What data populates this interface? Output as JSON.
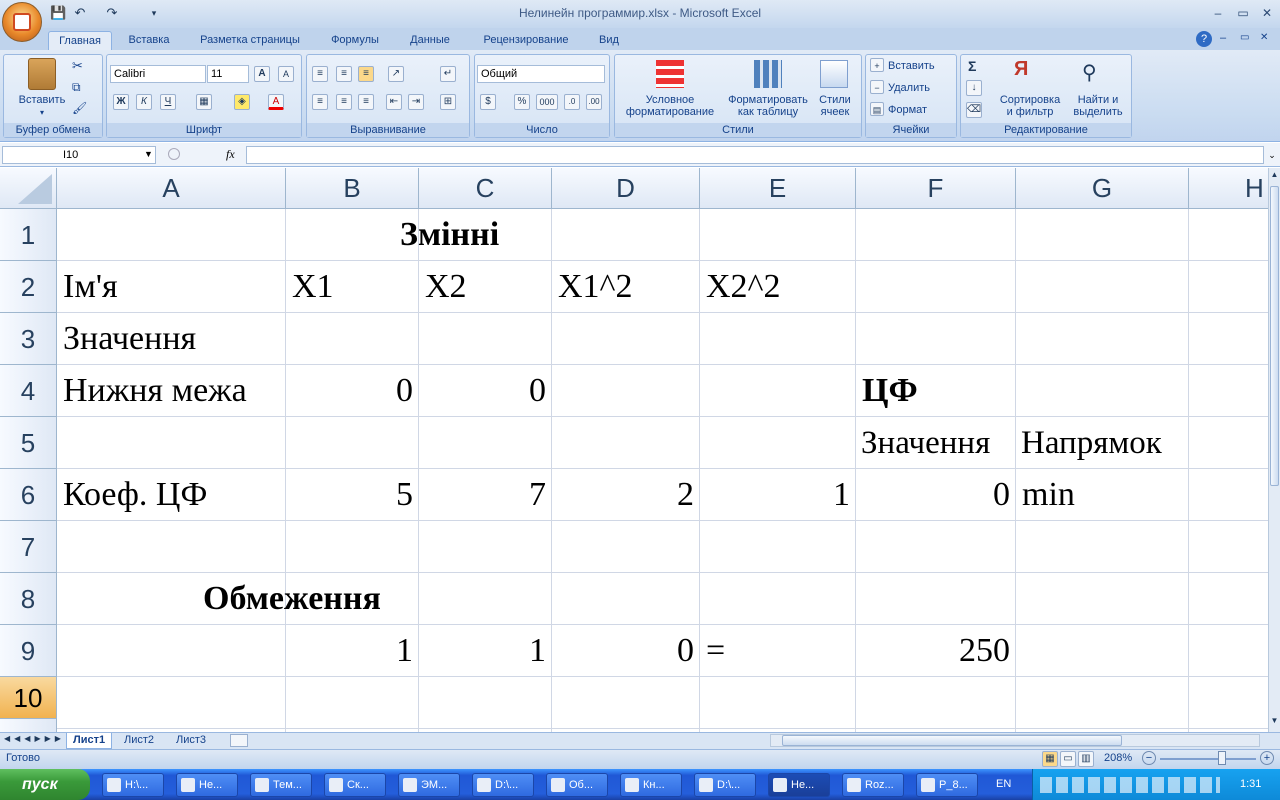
{
  "window": {
    "title": "Нелинейн программир.xlsx - Microsoft Excel"
  },
  "ribbon_tabs": [
    "Главная",
    "Вставка",
    "Разметка страницы",
    "Формулы",
    "Данные",
    "Рецензирование",
    "Вид"
  ],
  "ribbon": {
    "clipboard": {
      "paste": "Вставить",
      "group": "Буфер обмена"
    },
    "font": {
      "name": "Calibri",
      "size": "11",
      "bold": "Ж",
      "italic": "К",
      "underline": "Ч",
      "group": "Шрифт"
    },
    "alignment": {
      "group": "Выравнивание"
    },
    "number": {
      "format": "Общий",
      "group": "Число",
      "percent": "%",
      "thousands": "000"
    },
    "styles": {
      "conditional": "Условное форматирование",
      "as_table": "Форматировать как таблицу",
      "cell_styles": "Стили ячеек",
      "group": "Стили"
    },
    "cells": {
      "insert": "Вставить",
      "delete": "Удалить",
      "format": "Формат",
      "group": "Ячейки"
    },
    "editing": {
      "sort": "Сортировка и фильтр",
      "find": "Найти и выделить",
      "group": "Редактирование"
    }
  },
  "formula_bar": {
    "name_box": "I10",
    "fx": "fx",
    "value": ""
  },
  "columns": [
    "A",
    "B",
    "C",
    "D",
    "E",
    "F",
    "G",
    "H"
  ],
  "rows": [
    "1",
    "2",
    "3",
    "4",
    "5",
    "6",
    "7",
    "8",
    "9",
    "10"
  ],
  "cells": {
    "B1": "Змінні",
    "A2": "Ім'я",
    "B2": "X1",
    "C2": "X2",
    "D2": "X1^2",
    "E2": "X2^2",
    "A3": "Значення",
    "A4": "Нижня межа",
    "B4": "0",
    "C4": "0",
    "F4": "ЦФ",
    "F5": "Значення",
    "G5": "Напрямок",
    "A6": "Коеф. ЦФ",
    "B6": "5",
    "C6": "7",
    "D6": "2",
    "E6": "1",
    "F6": "0",
    "G6": "min",
    "A8": "Обмеження",
    "B9": "1",
    "C9": "1",
    "D9": "0",
    "E9": "=",
    "F9": "250"
  },
  "sheets": [
    "Лист1",
    "Лист2",
    "Лист3"
  ],
  "status": {
    "ready": "Готово",
    "zoom": "208%"
  },
  "taskbar": {
    "start": "пуск",
    "items": [
      "H:\\...",
      "Не...",
      "Тем...",
      "Ск...",
      "ЭМ...",
      "D:\\...",
      "Об...",
      "Кн...",
      "D:\\...",
      "Не...",
      "Roz...",
      "P_8..."
    ],
    "lang": "EN",
    "clock": "1:31"
  }
}
